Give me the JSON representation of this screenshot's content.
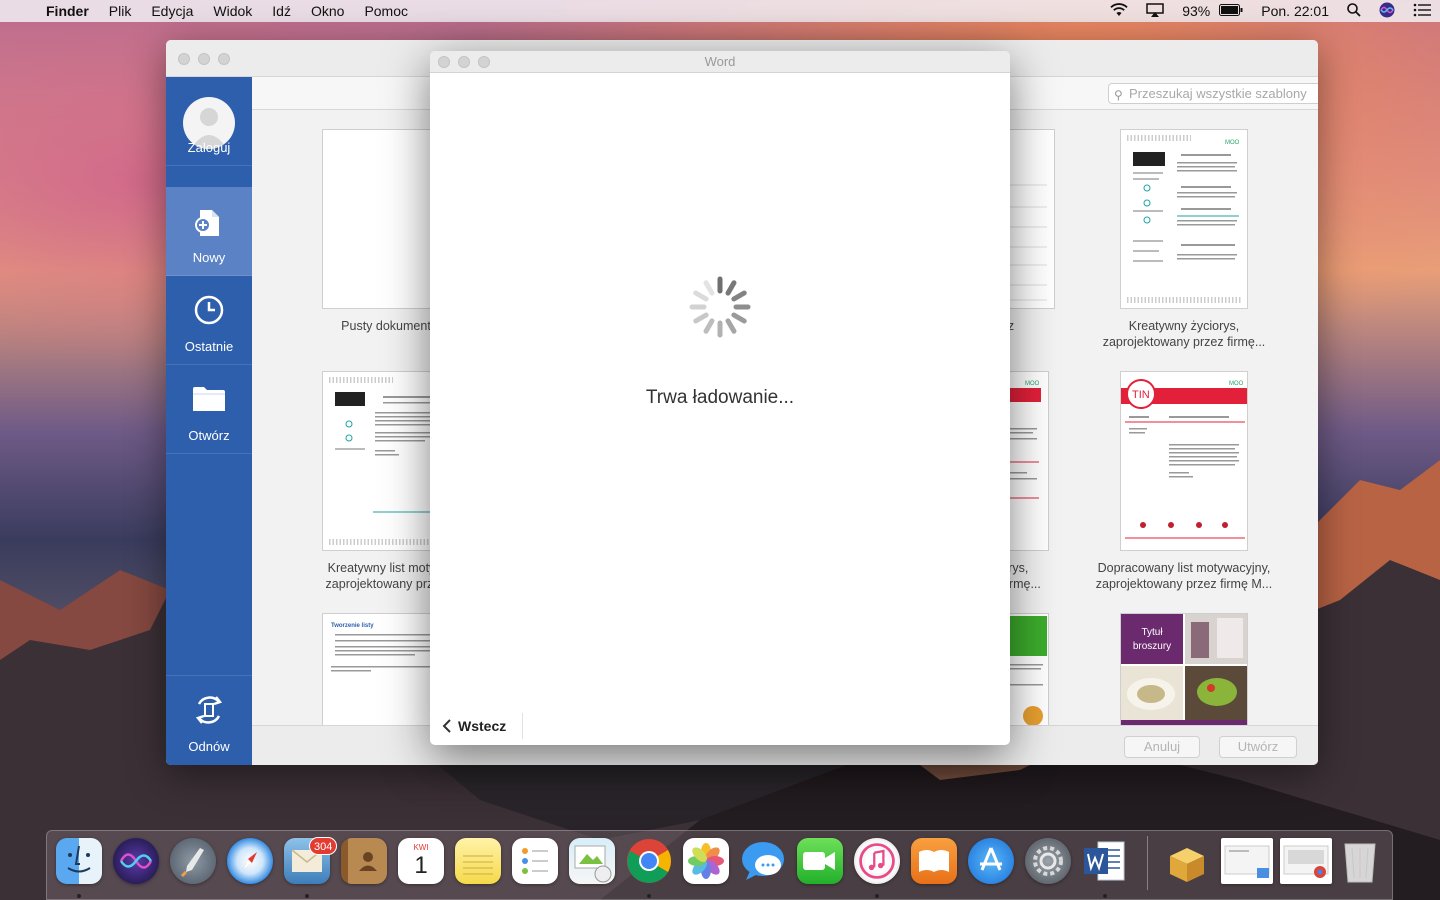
{
  "menubar": {
    "app_name": "Finder",
    "items": [
      "Plik",
      "Edycja",
      "Widok",
      "Idź",
      "Okno",
      "Pomoc"
    ],
    "battery": "93%",
    "clock": "Pon. 22:01"
  },
  "gallery": {
    "search_placeholder": "Przeszukaj wszystkie szablony",
    "sidebar": {
      "login": "Zaloguj",
      "new": "Nowy",
      "recent": "Ostatnie",
      "open": "Otwórz",
      "renew": "Odnów"
    },
    "templates": {
      "blank": "Pusty dokument",
      "creative_letter_l1": "Kreatywny list motyw",
      "creative_letter_l2": "zaprojektowany przez",
      "calendar_suffix": "z",
      "resume_mid_l1": "yciorys,",
      "resume_mid_l2": "ez firmę...",
      "creative_resume_l1": "Kreatywny życiorys,",
      "creative_resume_l2": "zaprojektowany przez firmę...",
      "polished_letter_l1": "Dopracowany list motywacyjny,",
      "polished_letter_l2": "zaprojektowany przez firmę M...",
      "list_heading": "Tworzenie listy",
      "brochure_title_l1": "Tytuł",
      "brochure_title_l2": "broszury",
      "moo_logo": "MOO",
      "tin_logo": "TIN"
    },
    "footer": {
      "cancel": "Anuluj",
      "create": "Utwórz"
    }
  },
  "dialog": {
    "title": "Word",
    "loading_text": "Trwa ładowanie...",
    "back": "Wstecz"
  },
  "dock": {
    "mail_badge": "304",
    "calendar_month": "KWI",
    "calendar_day": "1"
  },
  "colors": {
    "sidebar_blue": "#2e5fad",
    "sidebar_active": "#5a82c4",
    "brand_red": "#e3203a",
    "brand_teal": "#1fa3a3"
  }
}
